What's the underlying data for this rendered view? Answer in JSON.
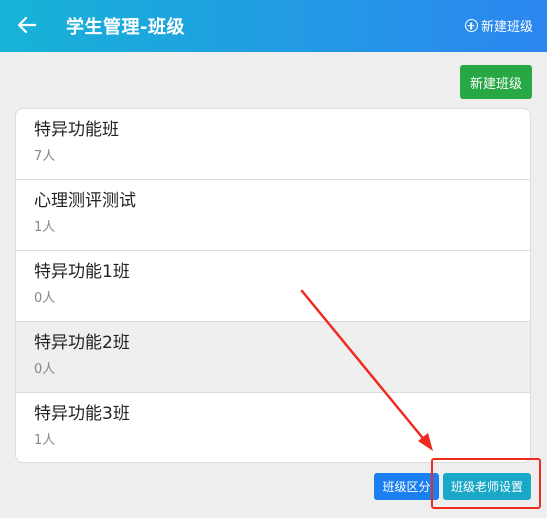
{
  "header": {
    "title": "学生管理-班级",
    "add_label": "新建班级"
  },
  "toolbar": {
    "new_class_label": "新建班级"
  },
  "classes": [
    {
      "name": "特异功能班",
      "count": "7人"
    },
    {
      "name": "心理测评测试",
      "count": "1人"
    },
    {
      "name": "特异功能1班",
      "count": "0人"
    },
    {
      "name": "特异功能2班",
      "count": "0人"
    },
    {
      "name": "特异功能3班",
      "count": "1人"
    }
  ],
  "footer": {
    "group_label": "班级区分",
    "teacher_label": "班级老师设置"
  },
  "colors": {
    "header_start": "#17b3d6",
    "header_end": "#2b86f0",
    "success": "#28a745",
    "primary": "#1a7ff0",
    "info": "#1aa8c8",
    "annotation": "#ef2a1e"
  },
  "icons": {
    "back": "arrow-left-icon",
    "add": "circle-plus-icon"
  }
}
